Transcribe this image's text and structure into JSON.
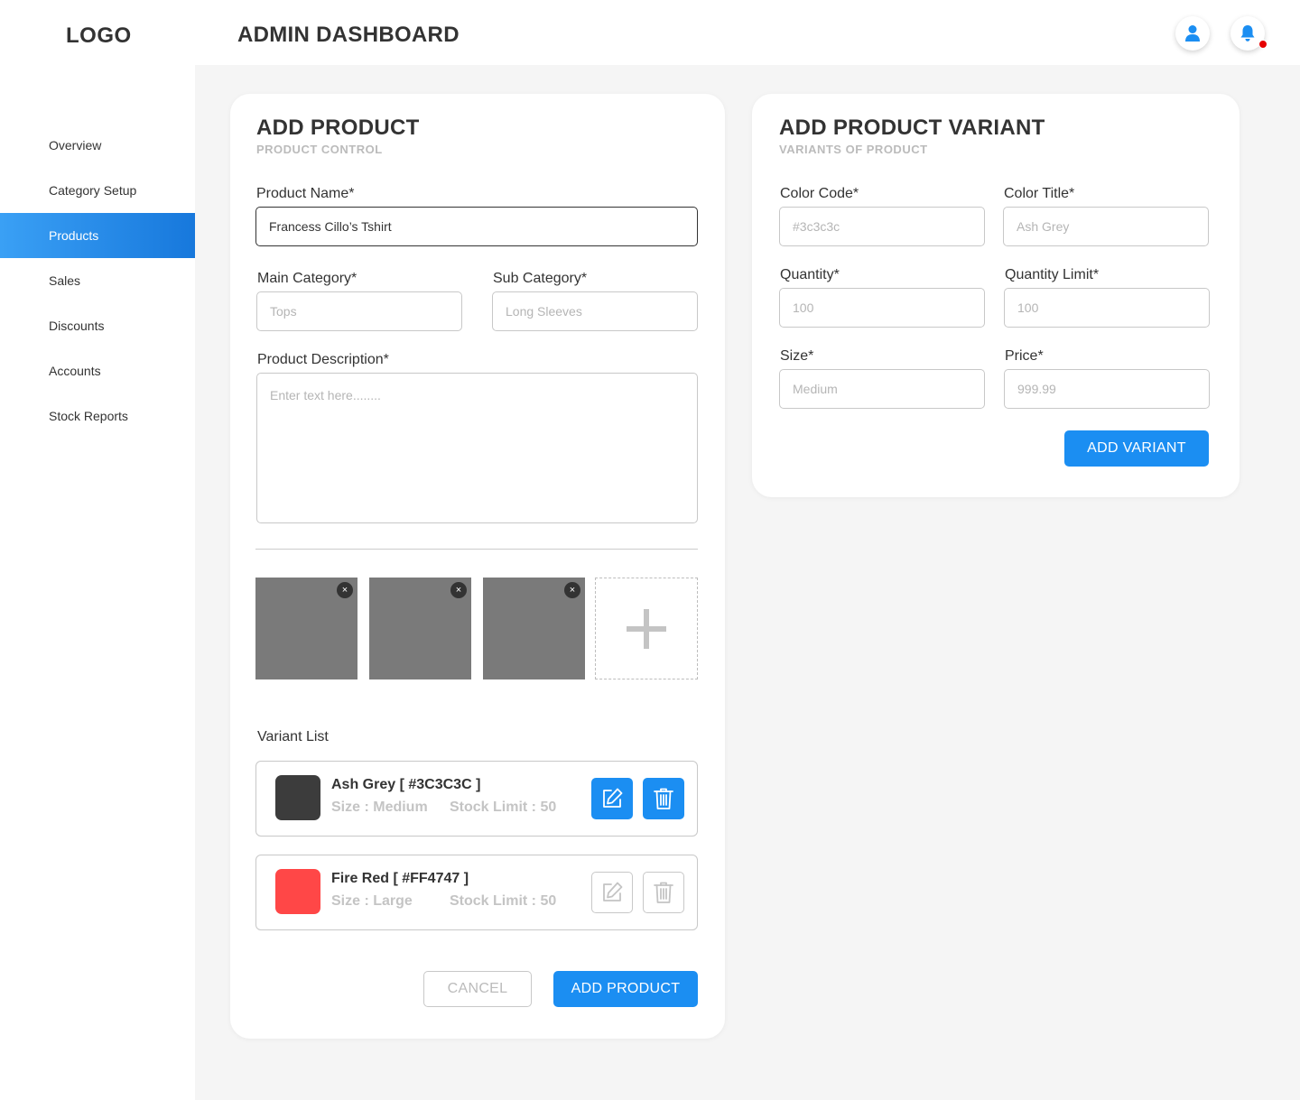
{
  "header": {
    "logo": "LOGO",
    "title": "ADMIN DASHBOARD"
  },
  "sidebar": {
    "items": [
      {
        "label": "Overview",
        "active": false
      },
      {
        "label": "Category Setup",
        "active": false
      },
      {
        "label": "Products",
        "active": true
      },
      {
        "label": "Sales",
        "active": false
      },
      {
        "label": "Discounts",
        "active": false
      },
      {
        "label": "Accounts",
        "active": false
      },
      {
        "label": "Stock Reports",
        "active": false
      }
    ]
  },
  "add_product": {
    "title": "ADD PRODUCT",
    "subtitle": "PRODUCT CONTROL",
    "product_name": {
      "label": "Product Name*",
      "value": "Francess Cillo’s Tshirt"
    },
    "main_category": {
      "label": "Main Category*",
      "placeholder": "Tops"
    },
    "sub_category": {
      "label": "Sub Category*",
      "placeholder": "Long Sleeves"
    },
    "description": {
      "label": "Product Description*",
      "placeholder": "Enter text here........"
    },
    "images": {
      "count": 3,
      "close_glyph": "×"
    },
    "variant_list": {
      "label": "Variant List",
      "items": [
        {
          "name": "Ash Grey [ #3C3C3C ]",
          "size": "Size : Medium",
          "stock": "Stock Limit : 50",
          "color": "#3c3c3c",
          "enabled": true
        },
        {
          "name": "Fire Red [ #FF4747 ]",
          "size": "Size : Large",
          "stock": "Stock Limit : 50",
          "color": "#ff4747",
          "enabled": false
        }
      ]
    },
    "cancel_label": "CANCEL",
    "submit_label": "ADD PRODUCT"
  },
  "add_variant": {
    "title": "ADD PRODUCT VARIANT",
    "subtitle": "VARIANTS OF PRODUCT",
    "color_code": {
      "label": "Color Code*",
      "placeholder": "#3c3c3c"
    },
    "color_title": {
      "label": "Color Title*",
      "placeholder": "Ash Grey"
    },
    "quantity": {
      "label": "Quantity*",
      "placeholder": "100"
    },
    "quantity_limit": {
      "label": "Quantity Limit*",
      "placeholder": "100"
    },
    "size": {
      "label": "Size*",
      "placeholder": "Medium"
    },
    "price": {
      "label": "Price*",
      "placeholder": "999.99"
    },
    "submit_label": "ADD VARIANT"
  },
  "colors": {
    "accent": "#1b8ef2",
    "notification": "#e60000"
  }
}
